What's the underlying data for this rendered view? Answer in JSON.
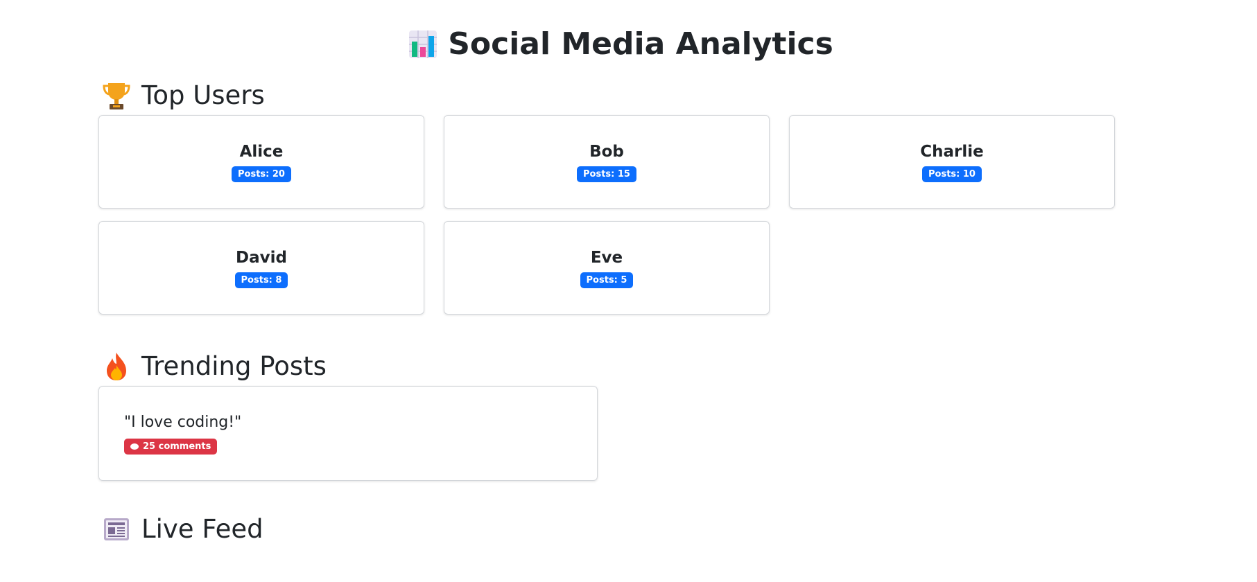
{
  "header": {
    "title": "Social Media Analytics",
    "icon": "bar-chart-icon"
  },
  "top_users": {
    "title": "Top Users",
    "icon": "trophy-icon",
    "users": [
      {
        "name": "Alice",
        "posts": "Posts: 20"
      },
      {
        "name": "Bob",
        "posts": "Posts: 15"
      },
      {
        "name": "Charlie",
        "posts": "Posts: 10"
      },
      {
        "name": "David",
        "posts": "Posts: 8"
      },
      {
        "name": "Eve",
        "posts": "Posts: 5"
      }
    ]
  },
  "trending": {
    "title": "Trending Posts",
    "icon": "fire-icon",
    "posts": [
      {
        "text": "\"I love coding!\"",
        "comments": "25 comments",
        "comment_icon": "speech-bubble-icon"
      }
    ]
  },
  "live_feed": {
    "title": "Live Feed",
    "icon": "newspaper-icon"
  },
  "colors": {
    "badge_primary": "#0d6efd",
    "badge_danger": "#dc3545",
    "text": "#212529"
  }
}
